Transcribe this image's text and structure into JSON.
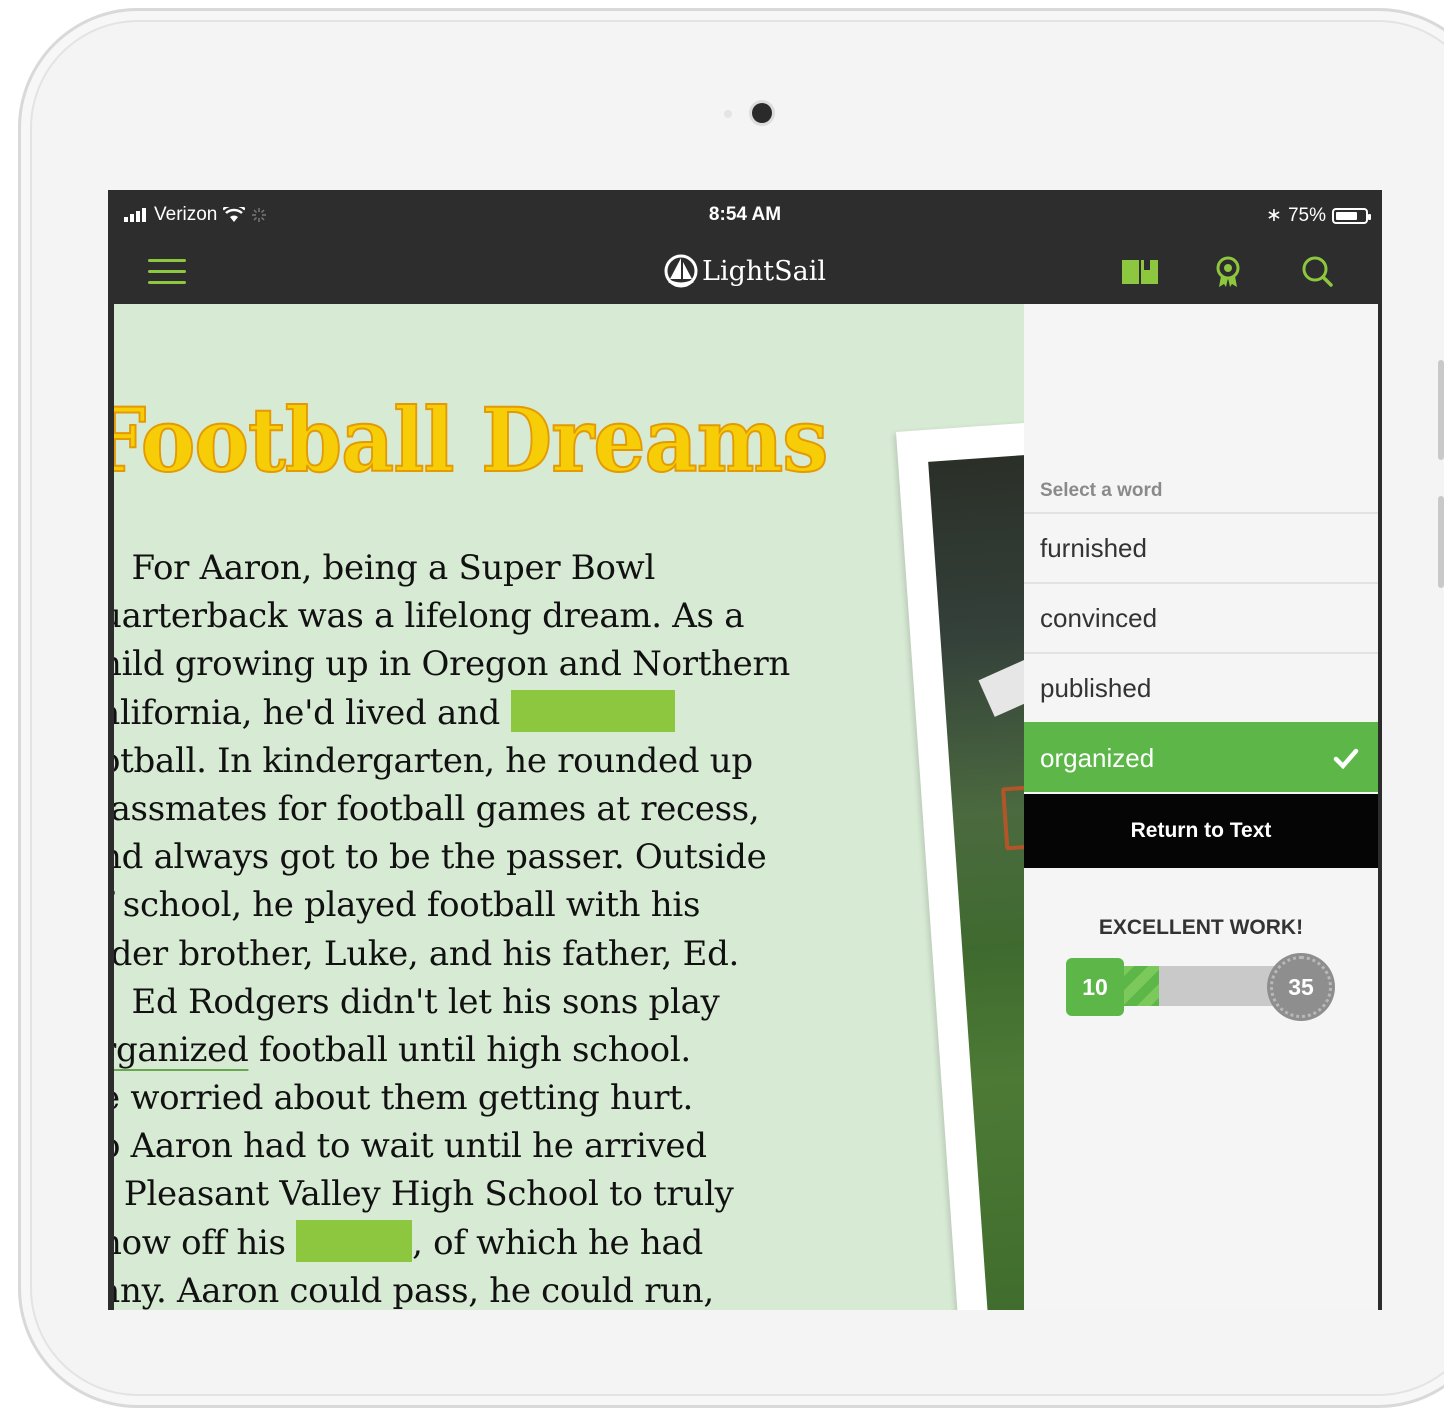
{
  "status_bar": {
    "carrier": "Verizon",
    "time": "8:54 AM",
    "battery_percent": "75%",
    "battery_level": 0.75
  },
  "app": {
    "name": "LightSail",
    "icons": [
      "menu-icon",
      "book-icon",
      "award-icon",
      "search-icon"
    ],
    "accent_color": "#8dc63f"
  },
  "reader": {
    "title": "Football Dreams",
    "lines": [
      {
        "before": "   For Aaron, being a Super Bowl"
      },
      {
        "before": "uarterback was a lifelong dream. As a"
      },
      {
        "before": "hild growing up in Oregon and Northern"
      },
      {
        "before": "alifornia, he'd lived and ",
        "blank": true
      },
      {
        "before": "otball. In kindergarten, he rounded up"
      },
      {
        "before": "lassmates for football games at recess,"
      },
      {
        "before": "nd always got to be the passer. Outside"
      },
      {
        "before": "f school, he played football with his"
      },
      {
        "before": "lder brother, Luke, and his father, Ed."
      },
      {
        "before": "   Ed Rodgers didn't let his sons play"
      },
      {
        "underlined": "rganized",
        "after": " football until high school."
      },
      {
        "before": "e worried about them getting hurt."
      },
      {
        "before": "o Aaron had to wait until he arrived"
      },
      {
        "before": "t Pleasant Valley High School to truly"
      },
      {
        "before": "how off his ",
        "blank": true,
        "after": ", of which he had"
      },
      {
        "before": "any. Aaron could pass, he could run,"
      }
    ]
  },
  "panel": {
    "label": "Select a word",
    "options": [
      "furnished",
      "convinced",
      "published",
      "organized"
    ],
    "selected": "organized",
    "return_label": "Return to Text",
    "feedback": "EXCELLENT WORK!",
    "progress_start": "10",
    "progress_goal": "35",
    "progress_fraction": 0.28
  }
}
